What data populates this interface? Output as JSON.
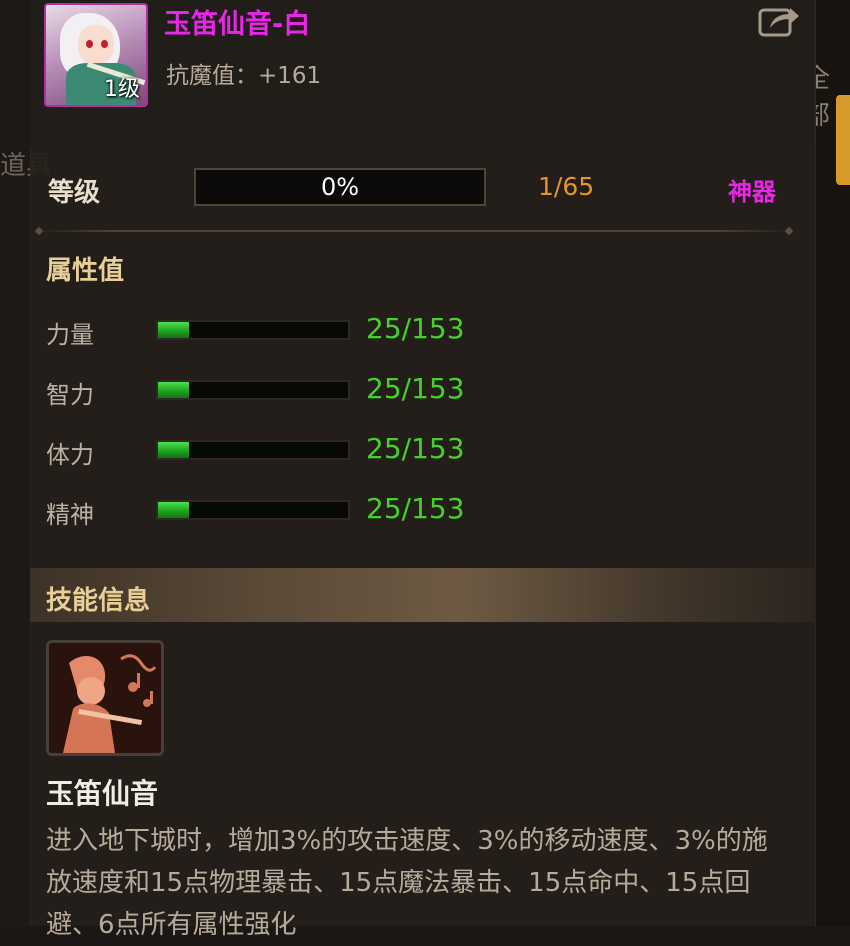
{
  "item": {
    "name": "玉笛仙音-白",
    "level_badge": "1级",
    "anti_magic": "抗魔值：+161",
    "level_label": "等级",
    "progress_text": "0%",
    "progress_fraction": 0,
    "level_count": "1/65",
    "rarity": "神器"
  },
  "attributes": {
    "title": "属性值",
    "rows": [
      {
        "label": "力量",
        "value": "25/153",
        "fraction": 0.1634
      },
      {
        "label": "智力",
        "value": "25/153",
        "fraction": 0.1634
      },
      {
        "label": "体力",
        "value": "25/153",
        "fraction": 0.1634
      },
      {
        "label": "精神",
        "value": "25/153",
        "fraction": 0.1634
      }
    ]
  },
  "skill": {
    "title": "技能信息",
    "name": "玉笛仙音",
    "description": "进入地下城时，增加3%的攻击速度、3%的移动速度、3%的施放速度和15点物理暴击、15点魔法暴击、15点命中、15点回避、6点所有属性强化"
  },
  "background": {
    "right_text": "全部",
    "left_text": "道具"
  },
  "colors": {
    "rarity": "#e628e6",
    "level_count": "#e8922a",
    "attr_value": "#46d02a",
    "section_title": "#e8cf98"
  },
  "icons": {
    "share": "share-arrow-icon",
    "avatar": "character-portrait",
    "skill": "flute-skill-icon"
  }
}
